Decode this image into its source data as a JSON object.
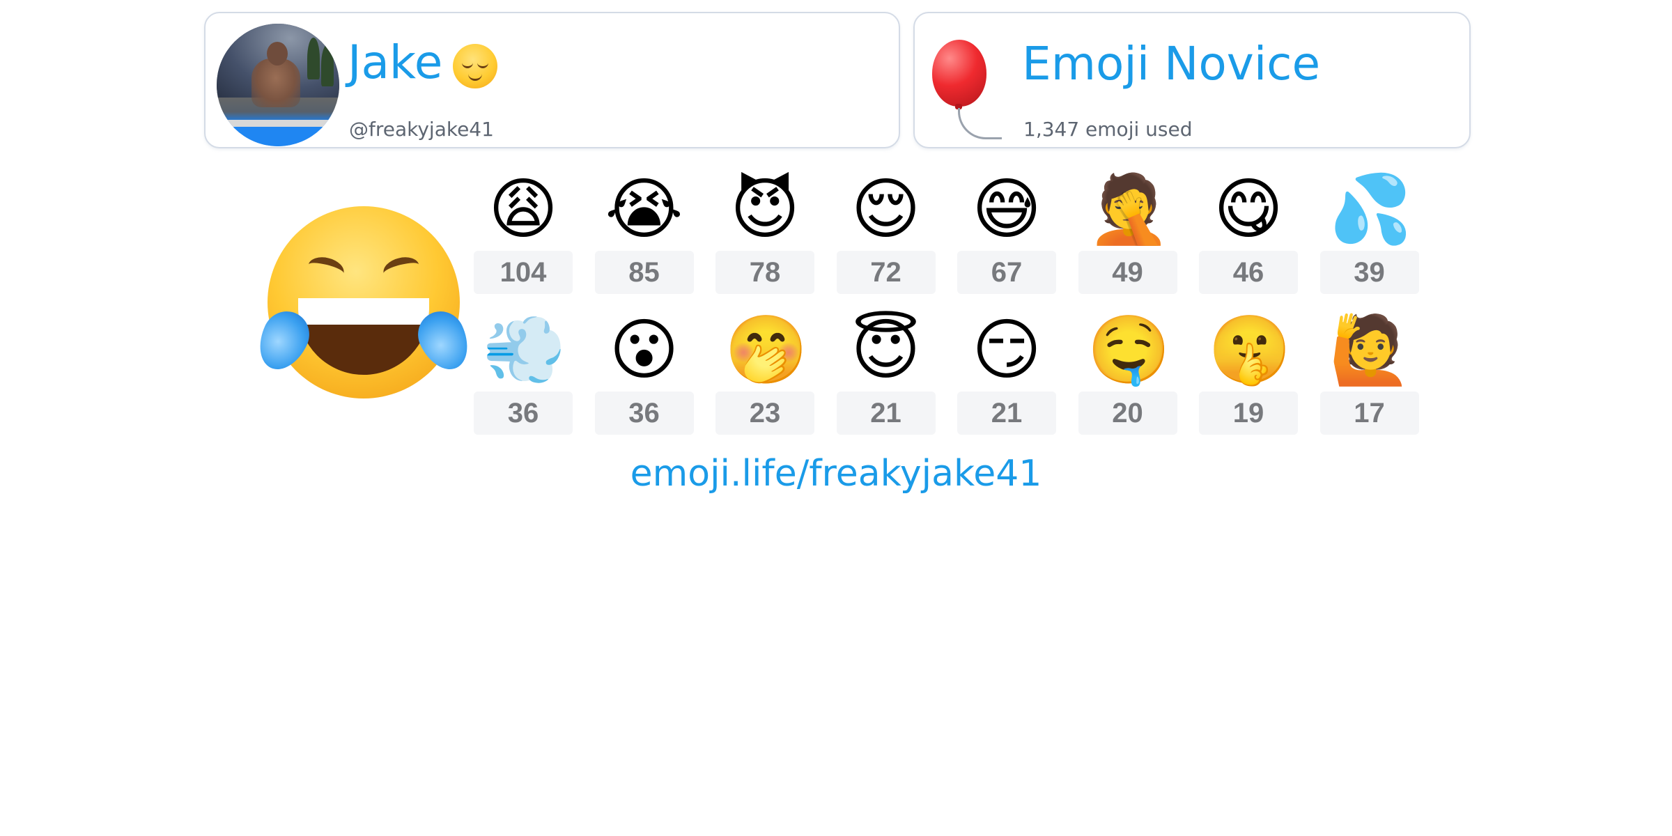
{
  "profile": {
    "name": "Jake",
    "name_emoji": "relieved-face",
    "handle": "@freakyjake41"
  },
  "badge": {
    "title": "Emoji Novice",
    "subtitle": "1,347 emoji used",
    "icon": "balloon"
  },
  "top_emoji": "face-with-tears-of-joy",
  "emoji_counts": [
    {
      "emoji": "weary-face",
      "count": "104"
    },
    {
      "emoji": "loudly-crying-face",
      "count": "85"
    },
    {
      "emoji": "smiling-face-with-horns",
      "count": "78"
    },
    {
      "emoji": "relieved-face",
      "count": "72"
    },
    {
      "emoji": "grinning-face-with-sweat",
      "count": "67"
    },
    {
      "emoji": "man-facepalming-medium-dark-skin",
      "count": "49"
    },
    {
      "emoji": "face-savoring-food",
      "count": "46"
    },
    {
      "emoji": "sweat-droplets",
      "count": "39"
    },
    {
      "emoji": "dashing-away",
      "count": "36"
    },
    {
      "emoji": "face-with-open-mouth",
      "count": "36"
    },
    {
      "emoji": "face-with-hand-over-mouth",
      "count": "23"
    },
    {
      "emoji": "smiling-face-with-halo",
      "count": "21"
    },
    {
      "emoji": "smirking-face",
      "count": "21"
    },
    {
      "emoji": "drooling-face",
      "count": "20"
    },
    {
      "emoji": "shushing-face",
      "count": "19"
    },
    {
      "emoji": "man-raising-hand-medium-skin",
      "count": "17"
    }
  ],
  "footer": {
    "link": "emoji.life/freakyjake41"
  },
  "colors": {
    "accent": "#1a9be8",
    "card_border": "#d4dbe6",
    "count_bg": "#f4f5f7",
    "count_text": "#77797d"
  }
}
